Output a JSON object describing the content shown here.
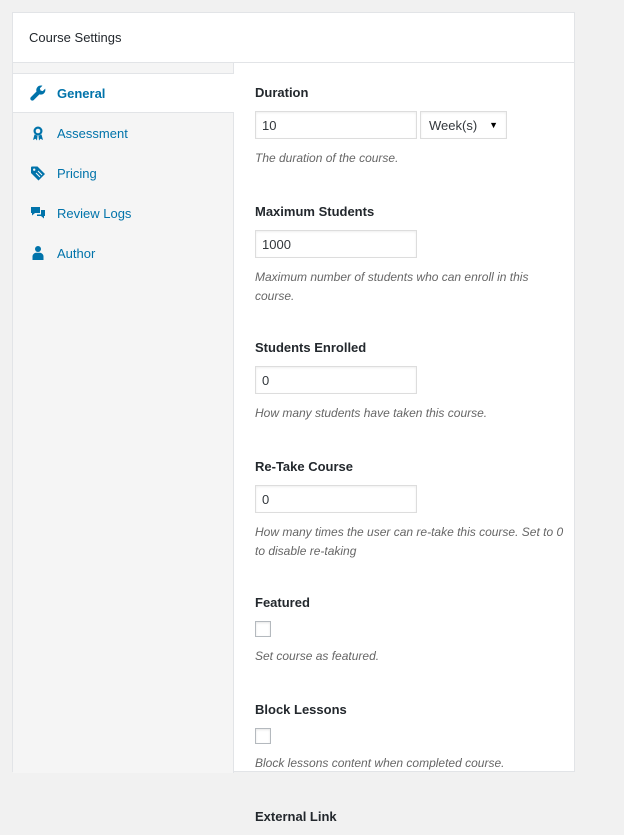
{
  "panel": {
    "title": "Course Settings"
  },
  "tabs": [
    {
      "label": "General",
      "icon": "wrench-icon",
      "active": true
    },
    {
      "label": "Assessment",
      "icon": "award-icon"
    },
    {
      "label": "Pricing",
      "icon": "tag-icon"
    },
    {
      "label": "Review Logs",
      "icon": "comments-icon"
    },
    {
      "label": "Author",
      "icon": "user-icon"
    }
  ],
  "fields": {
    "duration": {
      "label": "Duration",
      "value": "10",
      "unit": "Week(s)",
      "description": "The duration of the course."
    },
    "max_students": {
      "label": "Maximum Students",
      "value": "1000",
      "description": "Maximum number of students who can enroll in this course."
    },
    "students_enrolled": {
      "label": "Students Enrolled",
      "value": "0",
      "description": "How many students have taken this course."
    },
    "retake": {
      "label": "Re-Take Course",
      "value": "0",
      "description": "How many times the user can re-take this course. Set to 0 to disable re-taking"
    },
    "featured": {
      "label": "Featured",
      "checked": false,
      "description": "Set course as featured."
    },
    "block_lessons": {
      "label": "Block Lessons",
      "checked": false,
      "description": "Block lessons content when completed course."
    },
    "external_link": {
      "label": "External Link"
    }
  },
  "colors": {
    "link": "#0073aa",
    "border": "#e2e4e7",
    "description": "#666666"
  }
}
